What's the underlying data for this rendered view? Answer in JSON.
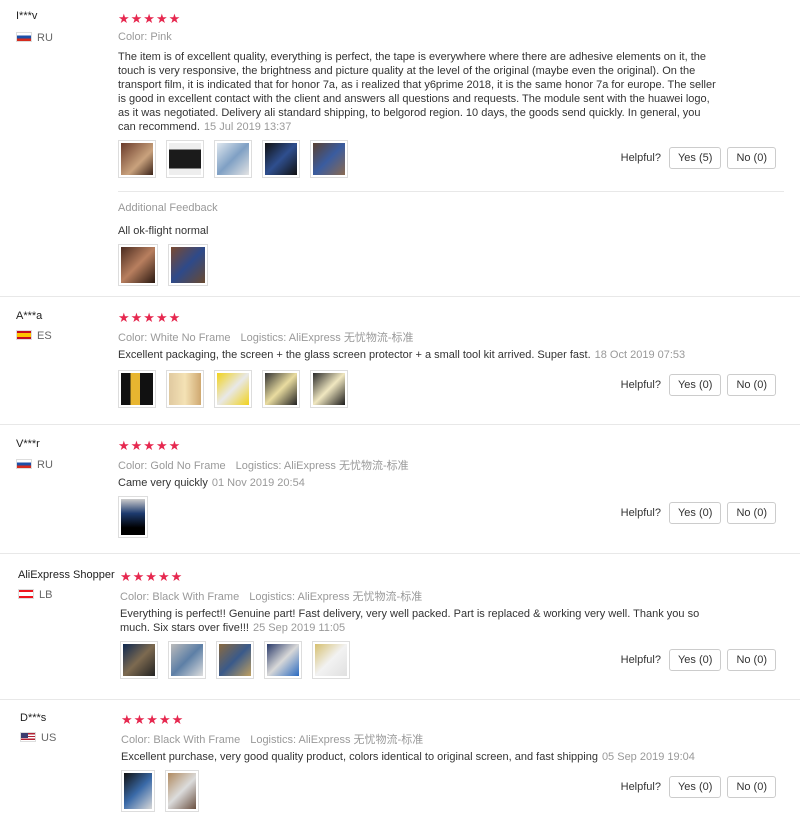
{
  "colors": {
    "star": "#e6284f",
    "muted": "#999999"
  },
  "helpful_label": "Helpful?",
  "reviews": [
    {
      "name": "I***v",
      "country": "RU",
      "flag": "ru",
      "stars": "★★★★★",
      "color_label": "Color:",
      "color": "Pink",
      "text": "The item is of excellent quality, everything is perfect, the tape is everywhere where there are adhesive elements on it, the touch is very responsive, the brightness and picture quality at the level of the original (maybe even the original). On the transport film, it is indicated that for honor 7a, as i realized that y6prime 2018, it is the same honor 7a for europe. The seller is good in excellent contact with the client and answers all questions and requests. The module sent with the huawei logo, as it was negotiated. Delivery ali standard shipping, to belgorod region. 10 days, the goods send quickly. In general, you can recommend.",
      "date": "15 Jul 2019 13:37",
      "yes": "Yes (5)",
      "no": "No (0)",
      "additional_title": "Additional Feedback",
      "additional_text": "All ok-flight normal"
    },
    {
      "name": "A***a",
      "country": "ES",
      "flag": "es",
      "stars": "★★★★★",
      "color_label": "Color:",
      "color": "White No Frame",
      "logistics_label": "Logistics:",
      "logistics": "AliExpress 无忧物流-标准",
      "text": "Excellent packaging, the screen + the glass screen protector + a small tool kit arrived. Super fast.",
      "date": "18 Oct 2019 07:53",
      "yes": "Yes (0)",
      "no": "No (0)"
    },
    {
      "name": "V***r",
      "country": "RU",
      "flag": "ru",
      "stars": "★★★★★",
      "color_label": "Color:",
      "color": "Gold No Frame",
      "logistics_label": "Logistics:",
      "logistics": "AliExpress 无忧物流-标准",
      "text": "Came very quickly",
      "date": "01 Nov 2019 20:54",
      "yes": "Yes (0)",
      "no": "No (0)"
    },
    {
      "name": "AliExpress Shopper",
      "country": "LB",
      "flag": "lb",
      "stars": "★★★★★",
      "color_label": "Color:",
      "color": "Black With Frame",
      "logistics_label": "Logistics:",
      "logistics": "AliExpress 无忧物流-标准",
      "text": "Everything is perfect!! Genuine part! Fast delivery, very well packed. Part is replaced & working very well. Thank you so much. Six stars over five!!!",
      "date": "25 Sep 2019 11:05",
      "yes": "Yes (0)",
      "no": "No (0)"
    },
    {
      "name": "D***s",
      "country": "US",
      "flag": "us",
      "stars": "★★★★★",
      "color_label": "Color:",
      "color": "Black With Frame",
      "logistics_label": "Logistics:",
      "logistics": "AliExpress 无忧物流-标准",
      "text": "Excellent purchase, very good quality product, colors identical to original screen, and fast shipping",
      "date": "05 Sep 2019 19:04",
      "yes": "Yes (0)",
      "no": "No (0)"
    }
  ]
}
